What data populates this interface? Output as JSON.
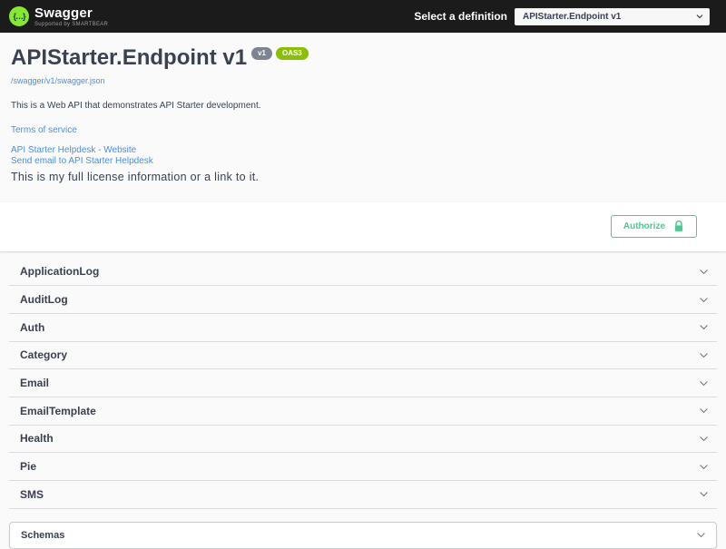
{
  "topbar": {
    "brand": "Swagger",
    "brand_sub": "Supported by SMARTBEAR",
    "logo_glyph": "{…}",
    "select_label": "Select a definition",
    "select_value": "APIStarter.Endpoint v1"
  },
  "info": {
    "title": "APIStarter.Endpoint v1",
    "version_badge": "v1",
    "oas_badge": "OAS3",
    "spec_link": "/swagger/v1/swagger.json",
    "description": "This is a Web API that demonstrates API Starter development.",
    "terms_link": "Terms of service",
    "website_link": "API Starter Helpdesk - Website",
    "email_link": "Send email to API Starter Helpdesk",
    "license": "This is my full license information or a link to it."
  },
  "auth": {
    "authorize_label": "Authorize"
  },
  "tags": [
    {
      "label": "ApplicationLog"
    },
    {
      "label": "AuditLog"
    },
    {
      "label": "Auth"
    },
    {
      "label": "Category"
    },
    {
      "label": "Email"
    },
    {
      "label": "EmailTemplate"
    },
    {
      "label": "Health"
    },
    {
      "label": "Pie"
    },
    {
      "label": "SMS"
    }
  ],
  "schemas": {
    "label": "Schemas"
  },
  "colors": {
    "topbar_bg": "#1b1b1b",
    "page_bg": "#fafafa",
    "logo_green": "#85ea2d",
    "oas_badge_green": "#89bf04",
    "version_badge_gray": "#7d8492",
    "link_blue": "#4990e2",
    "text_dark": "#3b4151",
    "authorize_green": "#49cc90"
  }
}
